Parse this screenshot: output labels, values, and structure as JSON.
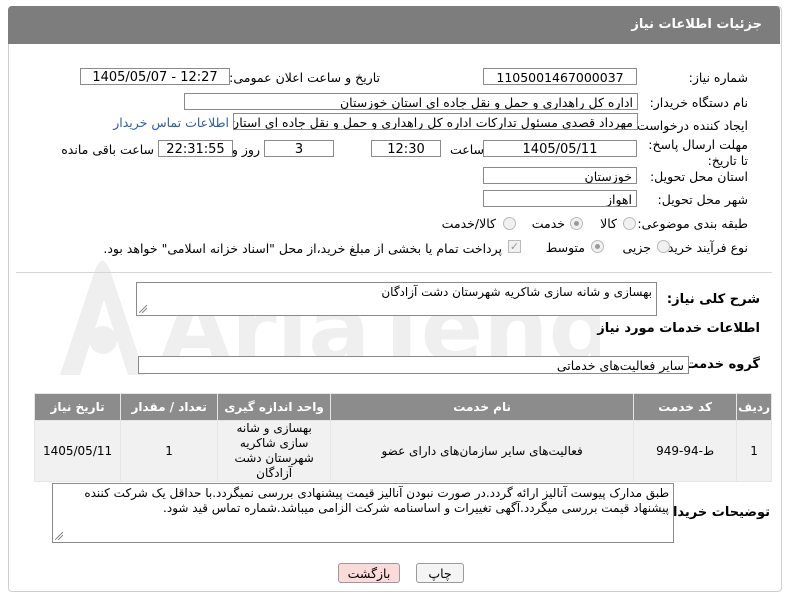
{
  "header": {
    "title": "جزئیات اطلاعات نیاز"
  },
  "watermark": {
    "brand": "AriaTender.neT"
  },
  "fields": {
    "need_number_label": "شماره نیاز:",
    "need_number": "1105001467000037",
    "announce_label": "تاریخ و ساعت اعلان عمومی:",
    "announce_value": "1405/05/07 - 12:27",
    "buyer_org_label": "نام دستگاه خریدار:",
    "buyer_org": "اداره کل راهداری و حمل و نقل جاده ای استان خوزستان",
    "creator_label": "ایجاد کننده درخواست:",
    "creator": "مهرداد قصدی مسئول تداركات اداره کل راهداری و حمل و نقل جاده ای استان خوزستان",
    "buyer_contact_link": "اطلاعات تماس خریدار",
    "deadline_label": "مهلت ارسال پاسخ: تا تاریخ:",
    "deadline_date": "1405/05/11",
    "time_label": "ساعت",
    "deadline_time": "12:30",
    "days_value": "3",
    "days_label": "روز و",
    "remaining_time": "22:31:55",
    "remaining_label": "ساعت باقی مانده",
    "province_label": "استان محل تحویل:",
    "province": "خوزستان",
    "city_label": "شهر محل تحویل:",
    "city": "اهواز",
    "category_label": "طبقه بندی موضوعی:",
    "category_options": [
      "کالا",
      "خدمت",
      "کالا/خدمت"
    ],
    "category_selected": "خدمت",
    "process_label": "نوع فرآیند خرید :",
    "process_options": [
      "جزیی",
      "متوسط"
    ],
    "process_selected": "متوسط",
    "payment_note": "پرداخت تمام یا بخشی از مبلغ خرید،از محل \"اسناد خزانه اسلامی\" خواهد بود."
  },
  "summary": {
    "label": "شرح کلی نیاز:",
    "value": "بهسازی و شانه سازی شاکریه شهرستان دشت آزادگان"
  },
  "services_section": {
    "title": "اطلاعات خدمات مورد نیاز",
    "group_label": "گروه خدمت:",
    "group_value": "سایر فعالیت‌های خدماتی"
  },
  "table": {
    "headers": [
      "ردیف",
      "کد خدمت",
      "نام خدمت",
      "واحد اندازه گیری",
      "تعداد / مقدار",
      "تاریخ نیاز"
    ],
    "rows": [
      {
        "row": "1",
        "code": "ط-94-949",
        "name": "فعالیت‌های سایر سازمان‌های دارای عضو",
        "unit": "بهسازی و شانه سازی شاکریه شهرستان دشت آزادگان",
        "qty": "1",
        "date": "1405/05/11"
      }
    ]
  },
  "buyer_notes": {
    "label": "توضیحات خریدار:",
    "value": "طبق  مدارک پیوست آنالیز ارائه گردد.در صورت نبودن آنالیز قیمت پیشنهادی بررسی نمیگردد.با حداقل یک شرکت کننده پیشنهاد قیمت بررسی میگردد.آگهی تغییرات و اساسنامه شرکت الزامی میباشد.شماره تماس قید شود."
  },
  "buttons": {
    "print": "چاپ",
    "back": "بازگشت"
  }
}
